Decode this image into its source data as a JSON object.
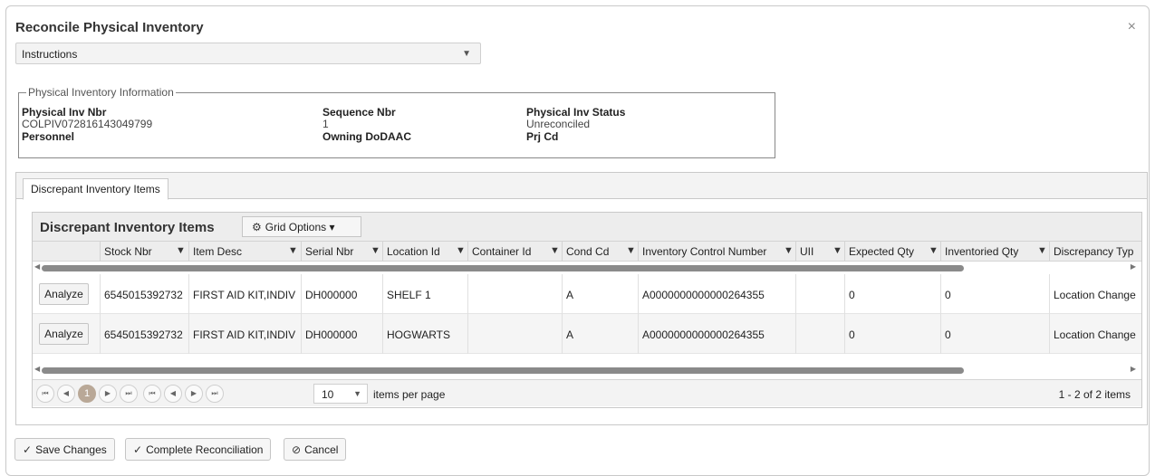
{
  "dialog": {
    "title": "Reconcile Physical Inventory",
    "close_glyph": "×"
  },
  "instructions": {
    "label": "Instructions",
    "caret": "▼"
  },
  "info": {
    "legend": "Physical Inventory Information",
    "physical_inv_nbr_label": "Physical Inv Nbr",
    "physical_inv_nbr_value": "COLPIV072816143049799",
    "sequence_nbr_label": "Sequence Nbr",
    "sequence_nbr_value": "1",
    "status_label": "Physical Inv Status",
    "status_value": "Unreconciled",
    "personnel_label": "Personnel",
    "owning_dodaac_label": "Owning DoDAAC",
    "prj_cd_label": "Prj Cd"
  },
  "tab": {
    "label": "Discrepant Inventory Items"
  },
  "grid": {
    "title": "Discrepant Inventory Items",
    "options_label": "Grid Options ▾",
    "columns": [
      "Stock Nbr",
      "Item Desc",
      "Serial Nbr",
      "Location Id",
      "Container Id",
      "Cond Cd",
      "Inventory Control Number",
      "UII",
      "Expected Qty",
      "Inventoried Qty",
      "Discrepancy Typ"
    ],
    "action_label": "Analyze",
    "rows": [
      {
        "stock_nbr": "6545015392732",
        "item_desc": "FIRST AID KIT,INDIV",
        "serial_nbr": "DH000000",
        "location_id": "SHELF 1",
        "container_id": "",
        "cond_cd": "A",
        "icn": "A0000000000000264355",
        "uii": "",
        "expected_qty": "0",
        "inventoried_qty": "0",
        "discrepancy": "Location Change"
      },
      {
        "stock_nbr": "6545015392732",
        "item_desc": "FIRST AID KIT,INDIV",
        "serial_nbr": "DH000000",
        "location_id": "HOGWARTS",
        "container_id": "",
        "cond_cd": "A",
        "icn": "A0000000000000264355",
        "uii": "",
        "expected_qty": "0",
        "inventoried_qty": "0",
        "discrepancy": "Location Change"
      }
    ]
  },
  "pager": {
    "current_page": "1",
    "page_size": "10",
    "items_per_page_label": "items per page",
    "info": "1 - 2 of 2 items"
  },
  "buttons": {
    "save": "Save Changes",
    "complete": "Complete Reconciliation",
    "cancel": "Cancel"
  }
}
